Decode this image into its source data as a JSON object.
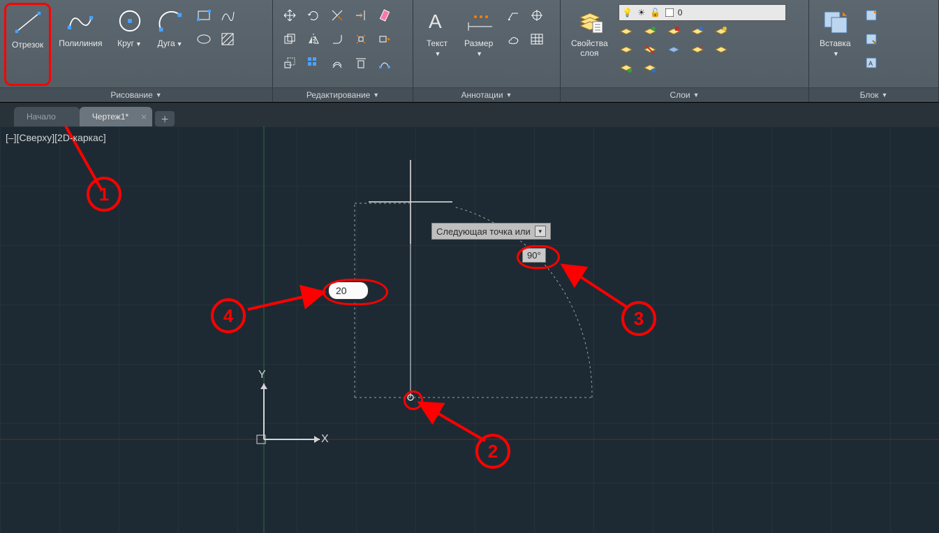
{
  "ribbon": {
    "draw": {
      "title": "Рисование",
      "line": "Отрезок",
      "polyline": "Полилиния",
      "circle": "Круг",
      "arc": "Дуга"
    },
    "edit": {
      "title": "Редактирование"
    },
    "anno": {
      "title": "Аннотации",
      "text": "Текст",
      "dim": "Размер"
    },
    "layers": {
      "title": "Слои",
      "props": "Свойства\nслоя",
      "current": "0"
    },
    "block": {
      "title": "Блок",
      "insert": "Вставка"
    }
  },
  "tabs": {
    "start": "Начало",
    "drawing": "Чертеж1*"
  },
  "view": {
    "label": "[–][Сверху][2D-каркас]"
  },
  "dyn": {
    "prompt": "Следующая точка или",
    "angle": "90°",
    "length": "20"
  },
  "ucs": {
    "x": "X",
    "y": "Y"
  },
  "callouts": {
    "c1": "1",
    "c2": "2",
    "c3": "3",
    "c4": "4"
  }
}
